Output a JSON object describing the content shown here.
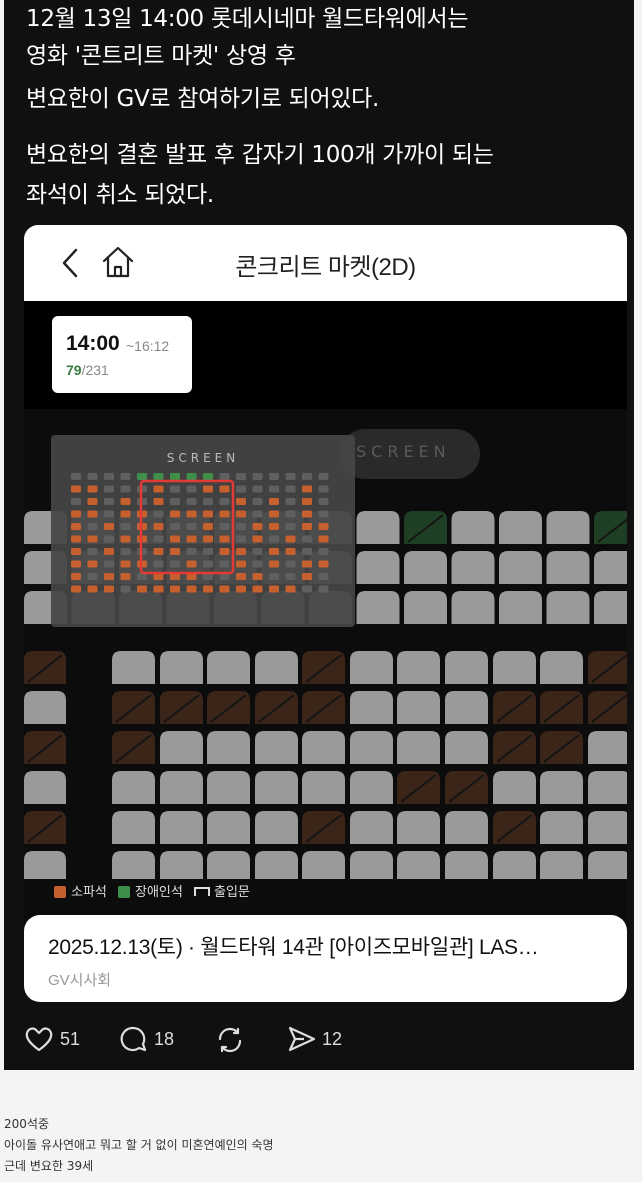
{
  "post": {
    "lines": [
      "12월 13일 14:00 롯데시네마 월드타워에서는",
      "영화 '콘트리트 마켓' 상영 후",
      "변요한이 GV로 참여하기로 되어있다.",
      "변요한의 결혼 발표 후 갑자기 100개 가까이 되는",
      "좌석이 취소 되었다."
    ]
  },
  "app": {
    "title": "콘크리트 마켓(2D)",
    "showtime": {
      "start": "14:00",
      "end": "~16:12",
      "available": "79",
      "total": "/231"
    },
    "screen_label": "SCREEN",
    "minimap_screen_label": "SCREEN",
    "legend": [
      {
        "label": "소파석",
        "color": "#c6602e"
      },
      {
        "label": "장애인석",
        "color": "#3f8f4a"
      },
      {
        "label": "출입문"
      }
    ],
    "info": {
      "title": "2025.12.13(토) · 월드타워 14관 [아이즈모바일관] LAS…",
      "subtitle": "GV시사회"
    }
  },
  "actions": {
    "likes": "51",
    "comments": "18",
    "shares": "12"
  },
  "caption": {
    "lines": [
      "200석중",
      "아이돌 유사연애고 뭐고 할 거 없이 미혼연예인의 숙명",
      "근데 변요한 39세"
    ]
  },
  "colors": {
    "sofa": "#c6602e",
    "sofa_sold": "#3b2418",
    "sold": "#8a8a8a",
    "available": "#9a9a9a",
    "accessible": "#3f8f4a",
    "accessible_sold": "#1e3f24",
    "highlight": "#e53935"
  },
  "seat_rows_main": [
    "ggggggggDgAgD",
    "ggggggggggggg",
    "ggggggggggggg"
  ],
  "seat_rows_lower": [
    "B.ggggSgggggS",
    "g.SSSSSgggSSS",
    "S.SgggggggSSg",
    "g.ggggggSSggg",
    "S.ggggSgggSgg",
    "g.ggggggggggg"
  ],
  "minimap_rows": [
    "....SSSSS.......",
    "OO...O..OO....O.",
    ".O.O.O....O.O.O.",
    "OO.OO.OOOOO.O.O.",
    "O.O.OO..O..OO.OO",
    "OO.OO.OOOO.O.O.O",
    "O.O..OO..OO.OO..",
    "OO.OO..O..O.O.OO",
    "O.OO.OOO..OO..O.",
    "OOO.OOOOOOOOOO.."
  ]
}
